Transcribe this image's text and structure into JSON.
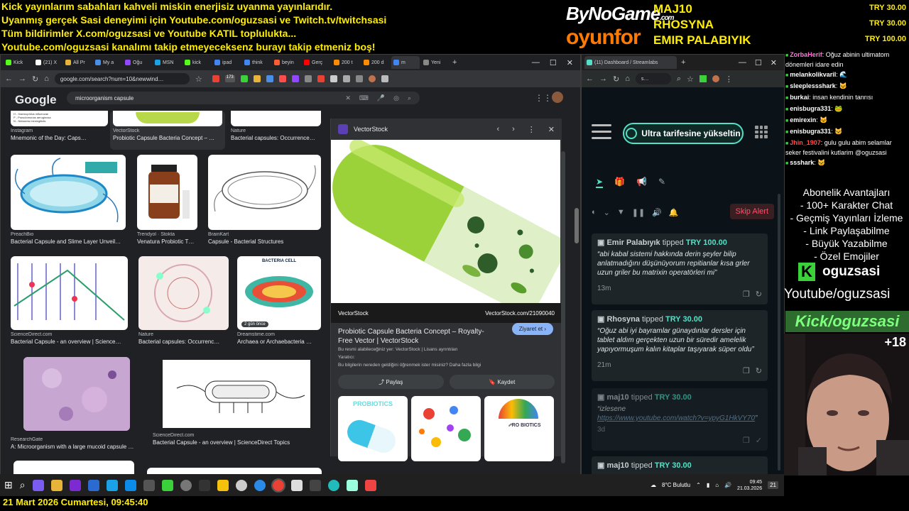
{
  "banner": {
    "line1": "Kick yayınlarım sabahları kahveli miskin enerjisiz uyanma yayınlarıdır.",
    "line2": "Uyanmış gerçek Sasi deneyimi için Youtube.com/oguzsasi ve Twitch.tv/twitchsasi",
    "line3": "Tüm bildirimler X.com/oguzsasi ve Youtube KATIL toplulukta...",
    "line4": "Youtube.com/oguzsasi kanalımı takip etmeyeceksenz burayı takip etmeniz boş!"
  },
  "logos": {
    "bynogame": "ByNoGame",
    "bynogame_dom": ".com",
    "oyunfor": "oyunfor"
  },
  "donors": [
    "MAJ10",
    "RHOSYNA",
    "EMIR PALABIYIK"
  ],
  "donor_amounts": [
    "TRY 30.00",
    "TRY 30.00",
    "TRY 100.00"
  ],
  "browser": {
    "tabs": [
      {
        "label": "Kick",
        "color": "#53fc18"
      },
      {
        "label": "(21) X",
        "color": "#ffffff"
      },
      {
        "label": "All Pr",
        "color": "#e8b339"
      },
      {
        "label": "My a",
        "color": "#4a8fe7"
      },
      {
        "label": "Oğu",
        "color": "#9146ff"
      },
      {
        "label": "MSN",
        "color": "#1aa1e6"
      },
      {
        "label": "kick",
        "color": "#53fc18"
      },
      {
        "label": "ipad",
        "color": "#4285f4"
      },
      {
        "label": "think",
        "color": "#4285f4"
      },
      {
        "label": "beyin",
        "color": "#ff5c35"
      },
      {
        "label": "Gerç",
        "color": "#ff0000"
      },
      {
        "label": "200 t",
        "color": "#ff8c00"
      },
      {
        "label": "200 d",
        "color": "#ff8c00"
      },
      {
        "label": "m",
        "color": "#4285f4"
      },
      {
        "label": "Yeni",
        "color": "#888888"
      }
    ],
    "url": "google.com/search?num=10&newwind…",
    "search_query": "microorganism capsule",
    "logo": "Google",
    "badge": "173"
  },
  "results": [
    {
      "source": "Instagram",
      "title": "Mnemonic of the Day: Caps…"
    },
    {
      "source": "VectorStock",
      "title": "Probiotic Capsule Bacteria Concept – …"
    },
    {
      "source": "Nature",
      "title": "Bacterial capsules: Occurrence…"
    },
    {
      "source": "PreachBio",
      "title": "Bacterial Capsule and Slime Layer Unveil…"
    },
    {
      "source": "Trendyol · Stokta",
      "title": "Venatura Probiotic T…"
    },
    {
      "source": "BrainKart",
      "title": "Capsule - Bacterial Structures"
    },
    {
      "source": "ScienceDirect.com",
      "title": "Bacterial Capsule - an overview | Science…"
    },
    {
      "source": "Nature",
      "title": "Bacterial capsules: Occurrenc…"
    },
    {
      "source": "Dreamstime.com",
      "title": "Archaea or Archaebacteria …"
    },
    {
      "source": "ResearchGate",
      "title": "A: Microorganism with a large mucoid capsule …"
    },
    {
      "source": "ScienceDirect.com",
      "title": "Bacterial Capsule - an overview | ScienceDirect Topics"
    }
  ],
  "result_badge": "2 gün önce",
  "bacteria_cell_label": "BACTERIA CELL",
  "panel": {
    "site": "VectorStock",
    "watermark": "VectorStock",
    "image_id": "VectorStock.com/21090040",
    "title": "Probiotic Capsule Bacteria Concept – Royalty-Free Vector | VectorStock",
    "visit": "Ziyaret et",
    "note1": "Bu resmi alabileceğiniz yer: VectorStock | Lisans ayrıntıları",
    "note2": "Yaratıcı:",
    "note3": "Bu bilgilerin nereden geldiğini öğrenmek ister misiniz? Daha fazla bilgi",
    "share": "Paylaş",
    "save": "Kaydet",
    "thumb1": "PROBIOTICS",
    "thumb3": "PRO BIOTICS"
  },
  "streamlabs": {
    "tab": "(11) Dashboard / Streamlabs",
    "upgrade": "Ultra tarifesine yükseltin",
    "skip": "Skip Alert",
    "tips": [
      {
        "name": "Emir Palabıyık",
        "verb": "tipped",
        "amount": "TRY 100.00",
        "msg": "“abi kabal sistemi hakkında derin şeyler bilip anlatmadığını düşünüyorum repitianlar kısa grler uzun griler bu matrixin operatörleri mi”",
        "time": "13m"
      },
      {
        "name": "Rhosyna",
        "verb": "tipped",
        "amount": "TRY 30.00",
        "msg": "“Oğuz abi iyi bayramlar günaydınlar dersler için tablet aldım gerçekten uzun bir süredir amelelik yapıyormuşum kalın kitaplar taşıyarak süper oldu”",
        "time": "21m"
      },
      {
        "name": "maj10",
        "verb": "tipped",
        "amount": "TRY 30.00",
        "msg": "“izlesene",
        "link": "https://www.youtube.com/watch?v=ypyG1HkVY70",
        "msg_end": "”",
        "time": "3d"
      },
      {
        "name": "maj10",
        "verb": "tipped",
        "amount": "TRY 30.00"
      }
    ]
  },
  "chat": [
    {
      "user": "ZorbaHerif",
      "color": "#ff7ad9",
      "text": ": Oğuz abinin ultimatom dönemleri idare edin"
    },
    {
      "user": "melankolikvaril",
      "color": "#ffffff",
      "text": ": 🌊"
    },
    {
      "user": "sleeplessshark",
      "color": "#ffffff",
      "text": ": 🐱"
    },
    {
      "user": "burkai",
      "color": "#ffffff",
      "text": ": insan kendinin tanrısı"
    },
    {
      "user": "enisbugra331",
      "color": "#ffffff",
      "text": ": 🐸"
    },
    {
      "user": "emirexin",
      "color": "#ffffff",
      "text": ": 🐱"
    },
    {
      "user": "enisbugra331",
      "color": "#ffffff",
      "text": ": 🐱"
    },
    {
      "user": "Jhin_1907",
      "color": "#ff4d4d",
      "text": ": gulu gulu abim selamlar seker festivalini kutlarim @oguzsasi"
    },
    {
      "user": "ssshark",
      "color": "#ffffff",
      "text": ": 🐱"
    }
  ],
  "promo": [
    "Abonelik Avantajları",
    "- 100+ Karakter Chat",
    "- Geçmiş Yayınları İzleme",
    "- Link Paylaşabilme",
    "- Büyük Yazabilme",
    "- Özel Emojiler"
  ],
  "kick_name": "oguzsasi",
  "kick_letter": "K",
  "yt": "Youtube/oguzsasi",
  "kick_bar": "Kick/oguzsasi",
  "plus": "+18",
  "taskbar": {
    "weather": "8°C  Bulutlu",
    "time": "09:45",
    "date": "21.03.2026",
    "notif": "21"
  },
  "dateline": "21 Mart 2026 Cumartesi, 09:45:40",
  "colors": {
    "accent": "#53e0c6",
    "banner_yellow": "#ffee00",
    "kick_green": "#53fc18"
  }
}
